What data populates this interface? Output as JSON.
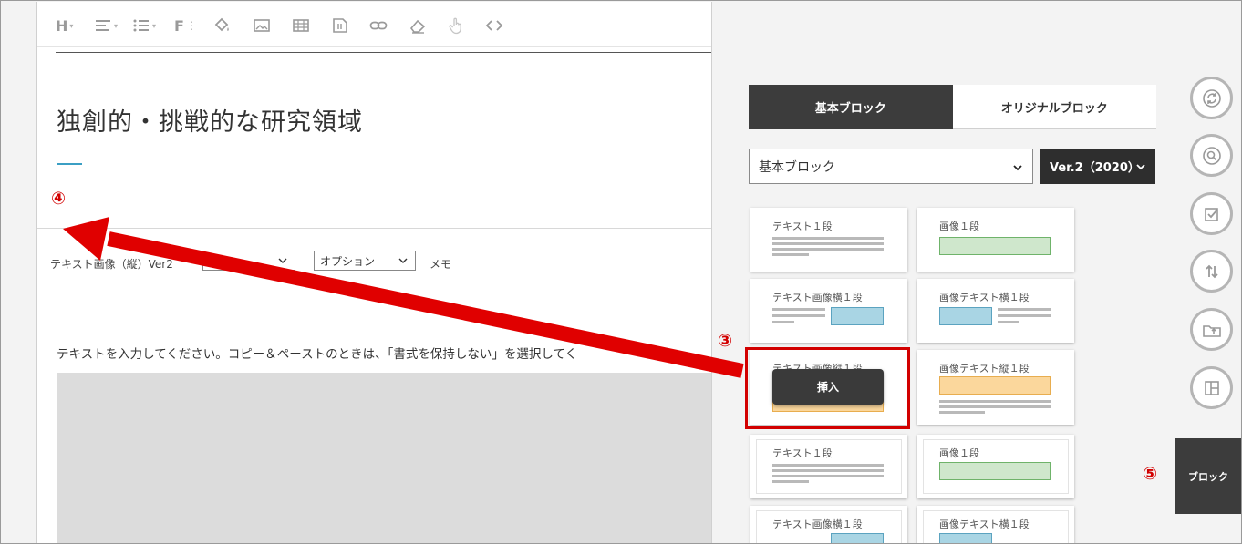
{
  "editor": {
    "heading": "独創的・挑戦的な研究領域",
    "block_label": "テキスト画像（縦）Ver2",
    "select1_value": "",
    "select2_value": "オプション",
    "memo": "メモ",
    "placeholder": "テキストを入力してください。コピー＆ペーストのときは、「書式を保持しない」を選択してく"
  },
  "toolbar": {
    "heading_glyph": "H",
    "font_glyph": "F"
  },
  "panel": {
    "tabs": [
      "基本ブロック",
      "オリジナルブロック"
    ],
    "category_select": "基本ブロック",
    "version": "Ver.2（2020）",
    "cards": [
      "テキスト１段",
      "画像１段",
      "テキスト画像横１段",
      "画像テキスト横１段",
      "テキスト画像縦１段",
      "画像テキスト縦１段",
      "テキスト１段",
      "画像１段",
      "テキスト画像横１段",
      "画像テキスト横１段"
    ],
    "insert_label": "挿入"
  },
  "sidebar": {
    "icons": [
      "refresh-icon",
      "zoom-icon",
      "check-icon",
      "sort-icon",
      "folder-upload-icon",
      "layout-icon"
    ],
    "block_tab": "ブロック"
  },
  "annotations": {
    "n3": "③",
    "n4": "④",
    "n5": "⑤",
    "color": "#d20000"
  }
}
